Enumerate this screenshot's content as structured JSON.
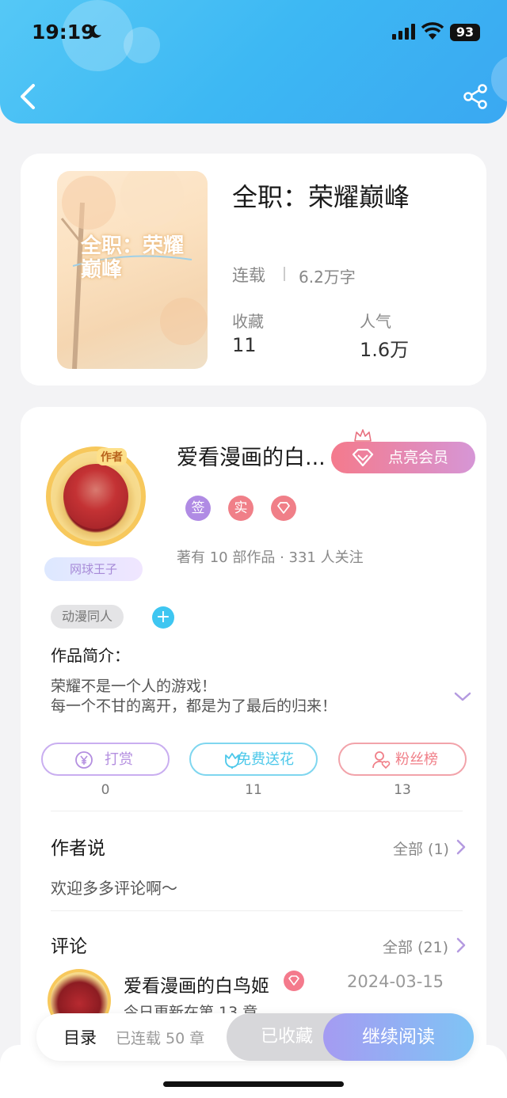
{
  "status_bar": {
    "time": "19:19",
    "battery": "93"
  },
  "book": {
    "title": "全职：荣耀巅峰",
    "status": "连载",
    "word_count": "6.2万字",
    "favorites_label": "收藏",
    "favorites_value": "11",
    "popularity_label": "人气",
    "popularity_value": "1.6万",
    "cover_title": "全职：荣耀巅峰"
  },
  "author": {
    "name": "爱看漫画的白...",
    "avatar_tag": "作者",
    "badge": "网球王子",
    "vip_button": "点亮会员",
    "badges": [
      "签",
      "实"
    ],
    "meta": "著有 10 部作品 · 331 人关注"
  },
  "tags": {
    "chip": "动漫同人",
    "add": "+"
  },
  "intro": {
    "title": "作品简介：",
    "lines": [
      "荣耀不是一个人的游戏！",
      "每一个不甘的离开，都是为了最后的归来！"
    ]
  },
  "actions": [
    {
      "label": "打赏",
      "count": "0",
      "color": "#b48fe0"
    },
    {
      "label": "免费送花",
      "count": "11",
      "color": "#4cc8ea"
    },
    {
      "label": "粉丝榜",
      "count": "13",
      "color": "#f07f88"
    }
  ],
  "author_says": {
    "title": "作者说",
    "all": "全部 (1)",
    "text": "欢迎多多评论啊～"
  },
  "comments": {
    "title": "评论",
    "all": "全部 (21)",
    "first": {
      "user": "爱看漫画的白鸟姬",
      "date": "2024-03-15",
      "text": "今日更新在第 13 章"
    }
  },
  "bottom": {
    "toc": "目录",
    "chapter_count": "已连载 50 章",
    "collected": "已收藏",
    "read": "继续阅读"
  },
  "colors": {
    "header_blue": "#3db8f3",
    "accent_purple": "#a59bf2",
    "accent_pink": "#f47a8c"
  }
}
